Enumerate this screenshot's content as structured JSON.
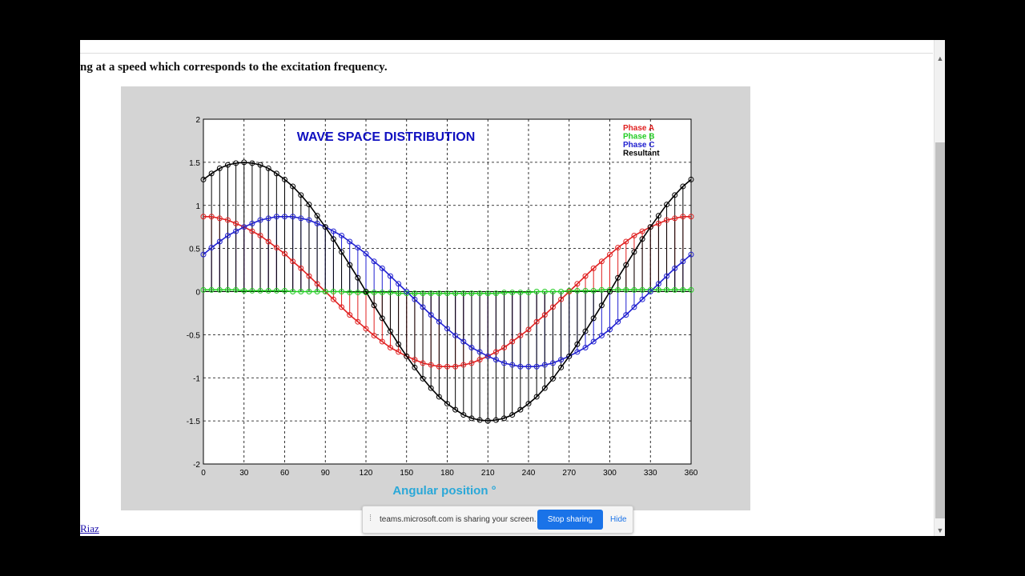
{
  "page": {
    "text_line": "ng at a speed which corresponds to the excitation frequency.",
    "author_link": "Riaz"
  },
  "share_bar": {
    "message": "teams.microsoft.com is sharing your screen.",
    "stop_label": "Stop sharing",
    "hide_label": "Hide"
  },
  "chart_data": {
    "type": "line",
    "title": "WAVE SPACE DISTRIBUTION",
    "xlabel": "Angular position °",
    "ylabel": "",
    "xlim": [
      0,
      360
    ],
    "ylim": [
      -2,
      2
    ],
    "x_ticks": [
      "0",
      "30",
      "60",
      "90",
      "120",
      "150",
      "180",
      "210",
      "240",
      "270",
      "300",
      "330",
      "360"
    ],
    "y_ticks": [
      "2",
      "1.5",
      "1",
      "0.5",
      "0",
      "-0.5",
      "-1",
      "-1.5",
      "-2"
    ],
    "grid": true,
    "legend_position": "top-right",
    "x": [
      0,
      6,
      12,
      18,
      24,
      30,
      36,
      42,
      48,
      54,
      60,
      66,
      72,
      78,
      84,
      90,
      96,
      102,
      108,
      114,
      120,
      126,
      132,
      138,
      144,
      150,
      156,
      162,
      168,
      174,
      180,
      186,
      192,
      198,
      204,
      210,
      216,
      222,
      228,
      234,
      240,
      246,
      252,
      258,
      264,
      270,
      276,
      282,
      288,
      294,
      300,
      306,
      312,
      318,
      324,
      330,
      336,
      342,
      348,
      354,
      360
    ],
    "series": [
      {
        "name": "Phase A",
        "color": "#e02020",
        "values": [
          0.87,
          0.87,
          0.85,
          0.83,
          0.79,
          0.75,
          0.7,
          0.65,
          0.58,
          0.51,
          0.44,
          0.35,
          0.27,
          0.18,
          0.09,
          0,
          -0.09,
          -0.18,
          -0.27,
          -0.35,
          -0.43,
          -0.51,
          -0.58,
          -0.65,
          -0.7,
          -0.75,
          -0.79,
          -0.83,
          -0.85,
          -0.87,
          -0.87,
          -0.87,
          -0.85,
          -0.83,
          -0.79,
          -0.75,
          -0.7,
          -0.65,
          -0.58,
          -0.51,
          -0.44,
          -0.35,
          -0.27,
          -0.18,
          -0.09,
          0,
          0.09,
          0.18,
          0.27,
          0.35,
          0.43,
          0.51,
          0.58,
          0.65,
          0.7,
          0.75,
          0.79,
          0.83,
          0.85,
          0.87,
          0.87
        ]
      },
      {
        "name": "Phase B",
        "color": "#22cc22",
        "values": [
          0.02,
          0.02,
          0.02,
          0.02,
          0.02,
          0.01,
          0.01,
          0.01,
          0.01,
          0.01,
          0.01,
          0,
          0,
          0,
          0,
          0,
          0,
          0,
          -0.01,
          -0.01,
          -0.01,
          -0.01,
          -0.01,
          -0.01,
          -0.02,
          -0.02,
          -0.02,
          -0.02,
          -0.02,
          -0.02,
          -0.02,
          -0.02,
          -0.02,
          -0.02,
          -0.02,
          -0.02,
          -0.02,
          -0.01,
          -0.01,
          -0.01,
          -0.01,
          0,
          0,
          0,
          0,
          0.01,
          0.01,
          0.01,
          0.01,
          0.02,
          0.02,
          0.02,
          0.02,
          0.02,
          0.02,
          0.02,
          0.02,
          0.02,
          0.02,
          0.02,
          0.02
        ]
      },
      {
        "name": "Phase C",
        "color": "#2020d0",
        "values": [
          0.43,
          0.51,
          0.58,
          0.65,
          0.7,
          0.75,
          0.79,
          0.83,
          0.85,
          0.87,
          0.87,
          0.87,
          0.85,
          0.83,
          0.79,
          0.75,
          0.7,
          0.65,
          0.58,
          0.51,
          0.44,
          0.35,
          0.27,
          0.18,
          0.09,
          0,
          -0.09,
          -0.18,
          -0.27,
          -0.35,
          -0.43,
          -0.51,
          -0.58,
          -0.65,
          -0.7,
          -0.75,
          -0.79,
          -0.83,
          -0.85,
          -0.87,
          -0.87,
          -0.87,
          -0.85,
          -0.83,
          -0.79,
          -0.75,
          -0.7,
          -0.65,
          -0.58,
          -0.51,
          -0.44,
          -0.35,
          -0.27,
          -0.18,
          -0.09,
          0,
          0.09,
          0.18,
          0.27,
          0.35,
          0.43
        ]
      },
      {
        "name": "Resultant",
        "color": "#000000",
        "values": [
          1.3,
          1.37,
          1.43,
          1.47,
          1.49,
          1.5,
          1.49,
          1.47,
          1.43,
          1.37,
          1.3,
          1.22,
          1.12,
          1.01,
          0.88,
          0.75,
          0.61,
          0.46,
          0.31,
          0.16,
          0,
          -0.16,
          -0.31,
          -0.46,
          -0.61,
          -0.75,
          -0.88,
          -1.01,
          -1.12,
          -1.22,
          -1.3,
          -1.37,
          -1.43,
          -1.47,
          -1.49,
          -1.5,
          -1.49,
          -1.47,
          -1.43,
          -1.37,
          -1.3,
          -1.22,
          -1.12,
          -1.01,
          -0.88,
          -0.75,
          -0.61,
          -0.46,
          -0.31,
          -0.16,
          0,
          0.16,
          0.31,
          0.46,
          0.61,
          0.75,
          0.88,
          1.01,
          1.12,
          1.22,
          1.3
        ]
      }
    ],
    "legend": [
      {
        "label": "Phase A",
        "color": "#e02020"
      },
      {
        "label": "Phase B",
        "color": "#22cc22"
      },
      {
        "label": "Phase C",
        "color": "#2020d0"
      },
      {
        "label": "Resultant",
        "color": "#000000"
      }
    ],
    "colors": {
      "title": "#1010c0",
      "xlabel": "#2aa8d8",
      "figure_bg": "#d4d4d4"
    }
  }
}
